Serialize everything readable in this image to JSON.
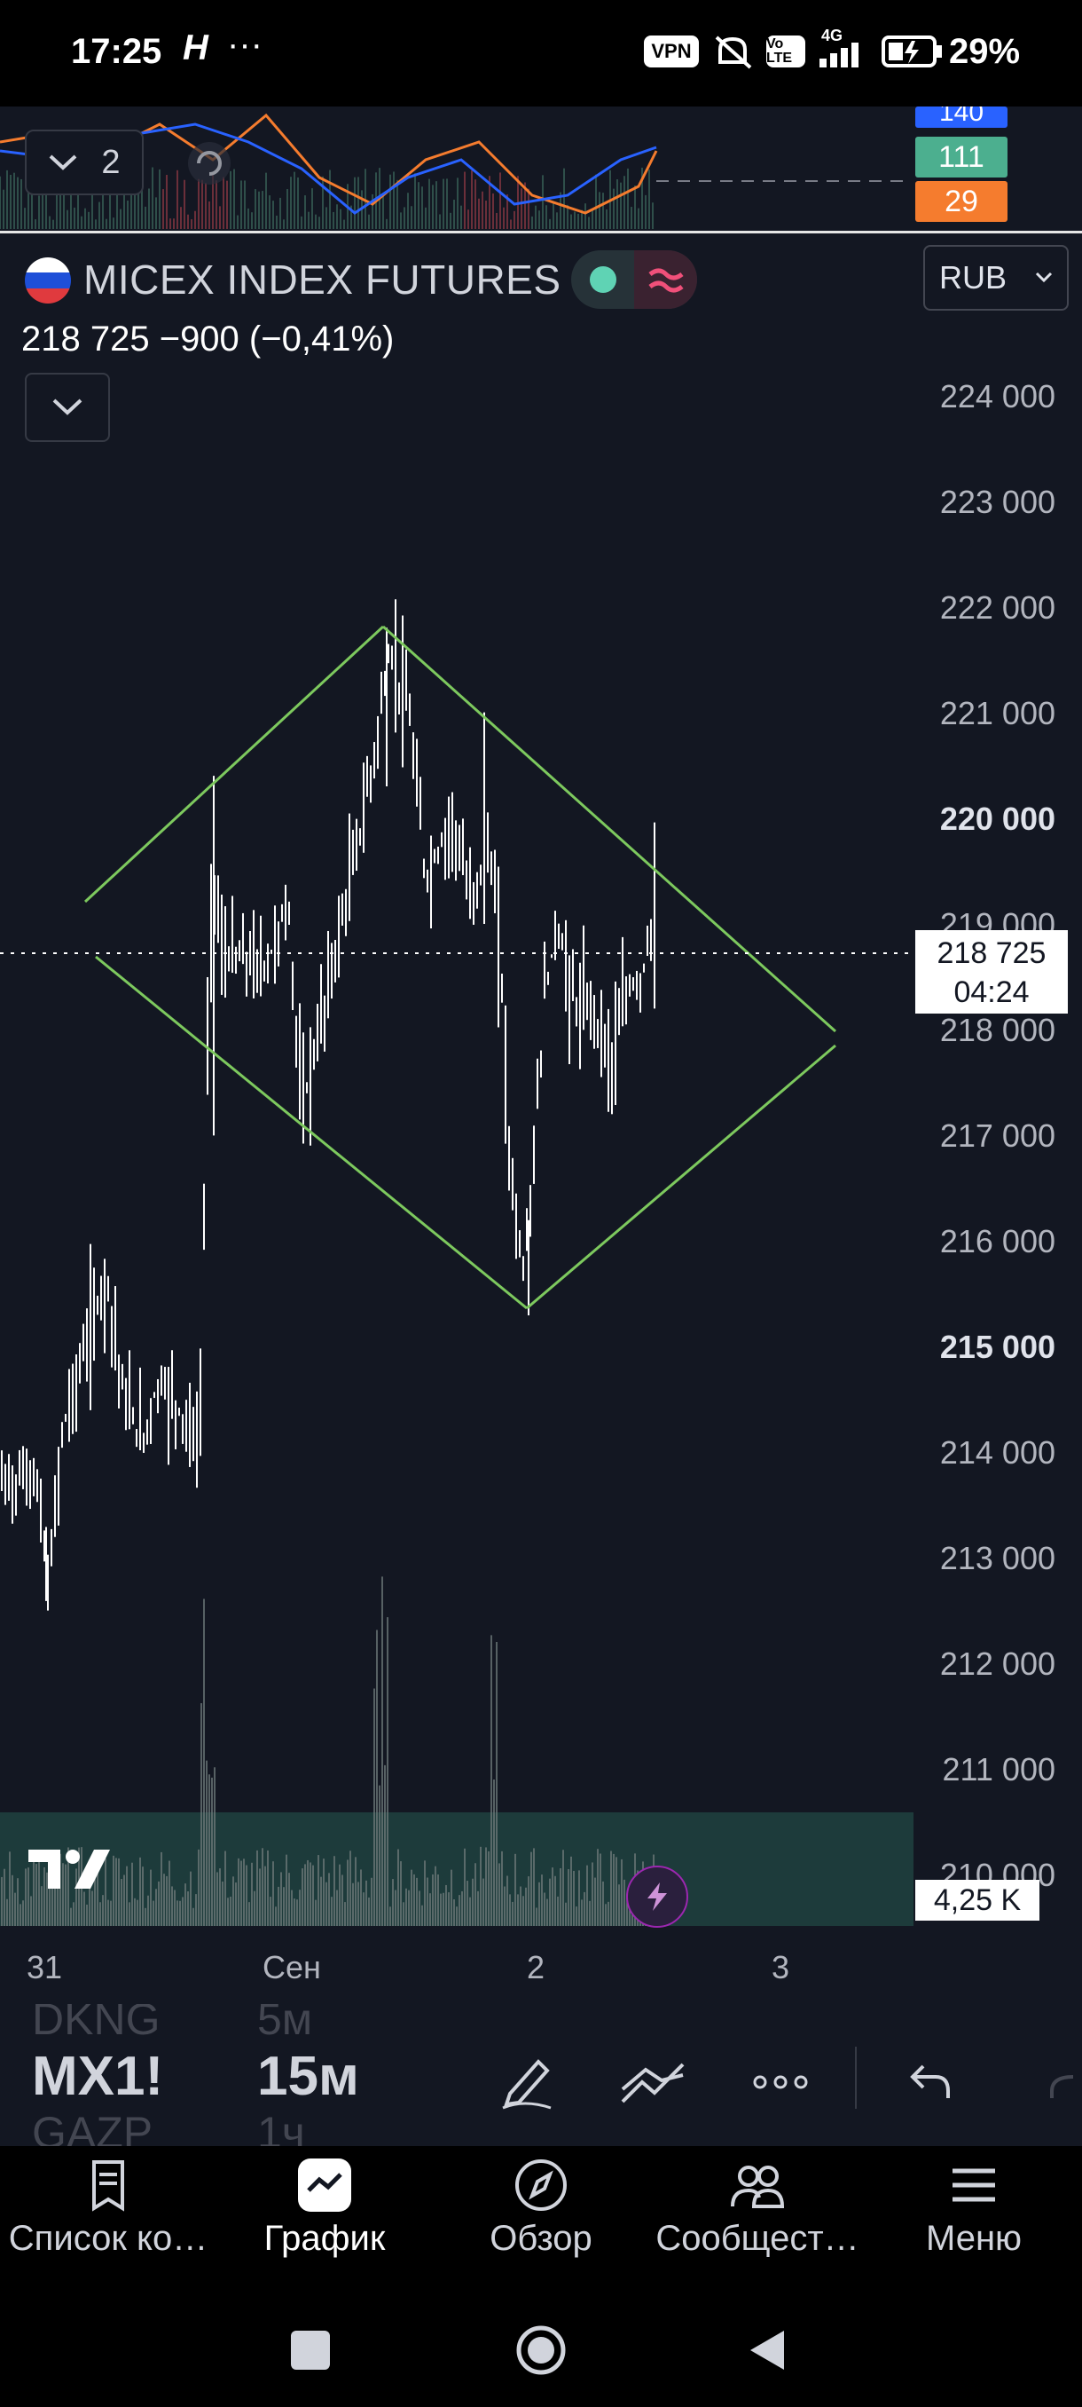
{
  "status_bar": {
    "time": "17:25",
    "notification_glyph": "H",
    "more": "···",
    "vpn": "VPN",
    "volte": "Vo LTE",
    "network": "4G",
    "battery": "29%"
  },
  "mini_pane": {
    "collapse_count": "2",
    "tags": [
      {
        "value": "140",
        "color": "#2962ff"
      },
      {
        "value": "111",
        "color": "#4caf8f"
      },
      {
        "value": "29",
        "color": "#f57c2e"
      }
    ]
  },
  "symbol": {
    "name": "MICEX INDEX FUTURES",
    "price_line": "218 725  −900 (−0,41%)",
    "currency": "RUB"
  },
  "price_axis": {
    "labels": [
      {
        "text": "224 000",
        "bold": false
      },
      {
        "text": "223 000",
        "bold": false
      },
      {
        "text": "222 000",
        "bold": false
      },
      {
        "text": "221 000",
        "bold": false
      },
      {
        "text": "220 000",
        "bold": true
      },
      {
        "text": "219 000",
        "bold": false
      },
      {
        "text": "218 000",
        "bold": false
      },
      {
        "text": "217 000",
        "bold": false
      },
      {
        "text": "216 000",
        "bold": false
      },
      {
        "text": "215 000",
        "bold": true
      },
      {
        "text": "214 000",
        "bold": false
      },
      {
        "text": "213 000",
        "bold": false
      },
      {
        "text": "212 000",
        "bold": false
      },
      {
        "text": "211 000",
        "bold": false
      },
      {
        "text": "210 000",
        "bold": false
      }
    ],
    "last_price": "218 725",
    "countdown": "04:24",
    "volume_label": "4,25 K"
  },
  "time_axis": {
    "labels": [
      "31",
      "Сен",
      "2",
      "3"
    ]
  },
  "switcher": {
    "prev_symbol": "DKNG",
    "prev_interval": "5м",
    "current_symbol": "MX1!",
    "current_interval": "15м",
    "next_symbol": "GAZP",
    "next_interval": "1ч"
  },
  "bottom_nav": {
    "items": [
      {
        "label": "Список ко…",
        "icon": "watchlist-icon"
      },
      {
        "label": "График",
        "icon": "chart-icon"
      },
      {
        "label": "Обзор",
        "icon": "compass-icon"
      },
      {
        "label": "Сообщест…",
        "icon": "community-icon"
      },
      {
        "label": "Меню",
        "icon": "menu-icon"
      }
    ]
  },
  "colors": {
    "background": "#131722",
    "trendline": "#7dc95e",
    "candle": "#ffffff",
    "volume_band": "#1d3b3b"
  }
}
